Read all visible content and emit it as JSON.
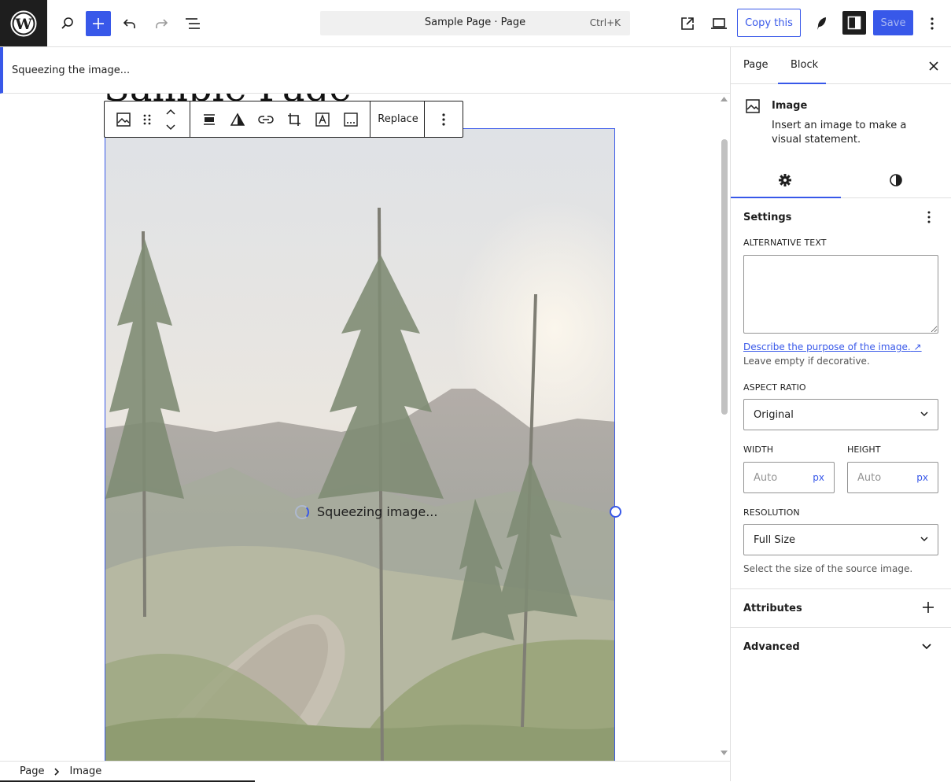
{
  "topbar": {
    "command_title": "Sample Page · Page",
    "command_shortcut": "Ctrl+K",
    "copy_label": "Copy this",
    "save_label": "Save",
    "accent_color": "#3858e9"
  },
  "notice": {
    "text": "Squeezing the image..."
  },
  "canvas": {
    "page_title": "Sample Page",
    "squeeze_text": "Squeezing image...",
    "replace_label": "Replace"
  },
  "breadcrumb": {
    "items": [
      "Page",
      "Image"
    ]
  },
  "sidebar": {
    "tabs": [
      "Page",
      "Block"
    ],
    "active_tab": "Block",
    "block_card": {
      "title": "Image",
      "description": "Insert an image to make a visual statement."
    },
    "settings": {
      "heading": "Settings",
      "alt_label": "ALTERNATIVE TEXT",
      "alt_value": "",
      "alt_link": "Describe the purpose of the image.",
      "alt_help": "Leave empty if decorative.",
      "aspect_label": "ASPECT RATIO",
      "aspect_value": "Original",
      "width_label": "WIDTH",
      "height_label": "HEIGHT",
      "width_placeholder": "Auto",
      "height_placeholder": "Auto",
      "unit": "px",
      "resolution_label": "RESOLUTION",
      "resolution_value": "Full Size",
      "resolution_help": "Select the size of the source image."
    },
    "panels": [
      "Attributes",
      "Advanced"
    ]
  },
  "icons": [
    "wordpress-icon",
    "search-icon",
    "plus-icon",
    "undo-icon",
    "redo-icon",
    "list-view-icon",
    "external-link-icon",
    "desktop-preview-icon",
    "feather-icon",
    "sidebar-icon",
    "more-vertical-icon"
  ]
}
